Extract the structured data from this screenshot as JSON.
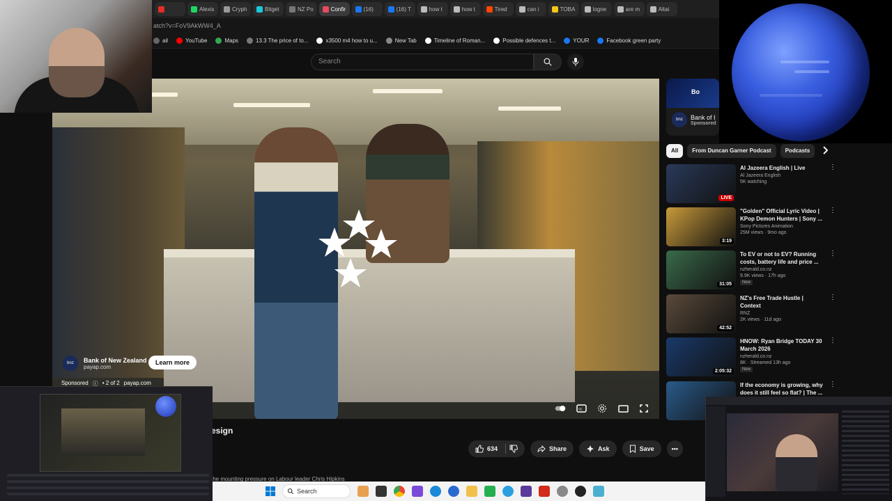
{
  "browser": {
    "tabs": [
      {
        "label": "",
        "color": "#e52d27"
      },
      {
        "label": "Alexis",
        "color": "#1ed760"
      },
      {
        "label": "Cryph",
        "color": "#999999"
      },
      {
        "label": "Bitget",
        "color": "#1ac8db"
      },
      {
        "label": "NZ Po",
        "color": "#777777"
      },
      {
        "label": "Confir",
        "color": "#e84a5f"
      },
      {
        "label": "(16)",
        "color": "#1877f2"
      },
      {
        "label": "(16) T",
        "color": "#1877f2"
      },
      {
        "label": "how t",
        "color": "#bbbbbb"
      },
      {
        "label": "how t",
        "color": "#bbbbbb"
      },
      {
        "label": "Tired",
        "color": "#ff4500"
      },
      {
        "label": "can i",
        "color": "#bbbbbb"
      },
      {
        "label": "TOBA",
        "color": "#f5c518"
      },
      {
        "label": "logne",
        "color": "#bbbbbb"
      },
      {
        "label": "are m",
        "color": "#bbbbbb"
      },
      {
        "label": "Altai",
        "color": "#bbbbbb"
      }
    ],
    "address": "atch?v=FoV9AkWW4_A",
    "bookmarks": [
      {
        "label": "ail",
        "color": "#666666"
      },
      {
        "label": "YouTube",
        "color": "#ff0000"
      },
      {
        "label": "Maps",
        "color": "#34a853"
      },
      {
        "label": "13.3 The price of to...",
        "color": "#777777"
      },
      {
        "label": "x3500 m4 how to u...",
        "color": "#ffffff"
      },
      {
        "label": "New Tab",
        "color": "#888888"
      },
      {
        "label": "Timeline of Roman...",
        "color": "#ffffff"
      },
      {
        "label": "Possible defences t...",
        "color": "#ffffff"
      },
      {
        "label": "YOUR",
        "color": "#1877f2"
      },
      {
        "label": "Facebook green party",
        "color": "#1877f2"
      }
    ]
  },
  "youtube": {
    "search_placeholder": "Search",
    "player": {
      "ad": {
        "advertiser": "Bank of New Zealand",
        "domain": "payap.com",
        "logo_text": "bnz",
        "cta": "Learn more",
        "footer_sponsored": "Sponsored",
        "footer_count": "2 of 2",
        "footer_domain": "payap.com"
      }
    },
    "video_title_fragment": "esign",
    "actions": {
      "likes": "634",
      "share": "Share",
      "ask": "Ask",
      "save": "Save"
    },
    "description_line": "the mounting pressure on Labour leader Chris Hipkins",
    "sponsored_card": {
      "banner_text": "Bo",
      "title": "Bank of I",
      "label": "Sponsored",
      "logo_text": "bnz"
    },
    "chips": [
      {
        "label": "All",
        "active": true
      },
      {
        "label": "From Duncan Garner Podcast",
        "active": false
      },
      {
        "label": "Podcasts",
        "active": false
      }
    ],
    "recommendations": [
      {
        "title": "Al Jazeera English | Live",
        "channel": "Al Jazeera English",
        "meta": "5K watching",
        "badge": "",
        "duration": "LIVE",
        "live": true,
        "thumb": "#2a3a5a"
      },
      {
        "title": "\"Golden\" Official Lyric Video | KPop Demon Hunters | Sony ...",
        "channel": "Sony Pictures Animation",
        "meta": "25M views · 9mo ago",
        "badge": "",
        "duration": "3:19",
        "live": false,
        "thumb": "#c89a3a"
      },
      {
        "title": "To EV or not to EV? Running costs, battery life and price ...",
        "channel": "nzherald.co.nz",
        "meta": "9.9K views · 17h ago",
        "badge": "New",
        "duration": "31:05",
        "live": false,
        "thumb": "#3a6a4a"
      },
      {
        "title": "NZ's Free Trade Hustle | Context",
        "channel": "RNZ",
        "meta": "2K views · 11d ago",
        "badge": "",
        "duration": "42:52",
        "live": false,
        "thumb": "#5a4a3a"
      },
      {
        "title": "HNOW: Ryan Bridge TODAY 30 March 2026",
        "channel": "nzherald.co.nz",
        "meta": "8K · Streamed 13h ago",
        "badge": "New",
        "duration": "2:05:32",
        "live": false,
        "thumb": "#1a3a6a"
      },
      {
        "title": "If the economy is growing, why does it still feel so flat? | The ...",
        "channel": "",
        "meta": "",
        "badge": "",
        "duration": "",
        "live": false,
        "thumb": "#2a5a8a"
      }
    ]
  },
  "overlays": {
    "taskbar_search": "Search"
  },
  "colors": {
    "yt_red": "#ff0000",
    "background": "#0f0f0f",
    "neptune": "#2a4fd0"
  }
}
